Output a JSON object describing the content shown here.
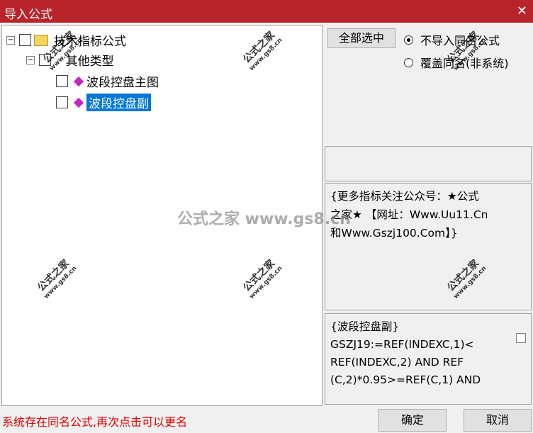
{
  "window": {
    "title": "导入公式",
    "close": "✕"
  },
  "tree": {
    "root_label": "技术指标公式",
    "group_label": "其他类型",
    "items": [
      "波段控盘主图",
      "波段控盘副"
    ],
    "collapse_glyph": "−"
  },
  "right": {
    "select_all": "全部选中",
    "radio1": "不导入同名公式",
    "radio2": "覆盖同名(非系统)",
    "radio_selected": "radio1",
    "desc_lines": [
      "{更多指标关注公众号：★公式",
      "之家★ 【网址：Www.Uu11.Cn",
      "和Www.Gszj100.Com】}"
    ],
    "code_lines": [
      "{波段控盘副}",
      "GSZJ19:=REF(INDEXC,1)<",
      "REF(INDEXC,2) AND REF",
      "(C,2)*0.95>=REF(C,1) AND"
    ]
  },
  "status": "系统存在同名公式,再次点击可以更名",
  "buttons": {
    "ok": "确定",
    "cancel": "取消"
  },
  "watermark": {
    "cn": "公式之家",
    "url": "www.gs8.cn",
    "center": "公式之家 www.gs8.cn"
  },
  "colors": {
    "titlebar": "#b8242a",
    "selection": "#0078d7",
    "status_text": "#e00000"
  }
}
